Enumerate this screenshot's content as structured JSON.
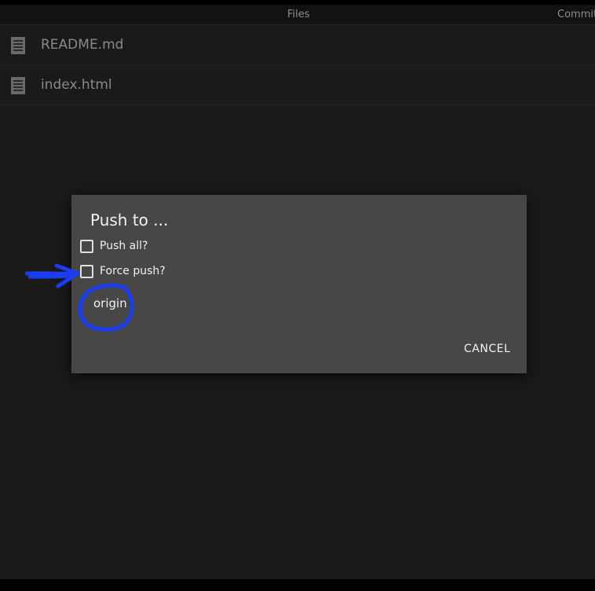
{
  "tabs": {
    "files": "Files",
    "commits": "Commit"
  },
  "files": [
    {
      "name": "README.md",
      "icon": "document-icon"
    },
    {
      "name": "index.html",
      "icon": "document-icon"
    }
  ],
  "dialog": {
    "title": "Push to ...",
    "options": [
      {
        "label": "Push all?",
        "checked": false
      },
      {
        "label": "Force push?",
        "checked": false
      }
    ],
    "remote": "origin",
    "cancel_label": "CANCEL"
  },
  "colors": {
    "background": "#1a1a1a",
    "dialog": "#474747",
    "annotation": "#1a3df0"
  }
}
